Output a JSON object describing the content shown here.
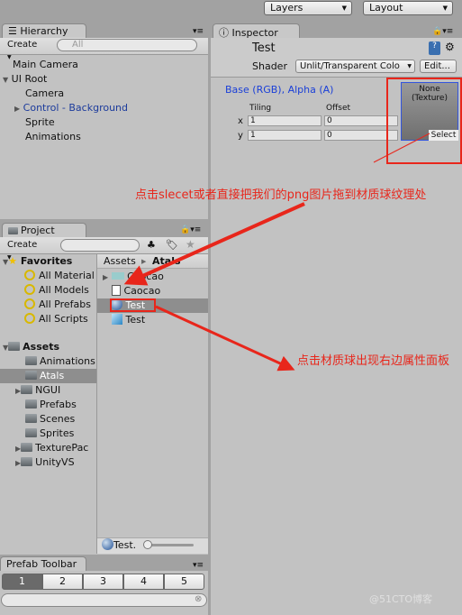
{
  "toolbar": {
    "layers": "Layers",
    "layout": "Layout"
  },
  "hierarchy": {
    "tab": "Hierarchy",
    "create": "Create",
    "search_placeholder": "All",
    "items": [
      "Main Camera",
      "UI Root",
      "Camera",
      "Control - Background",
      "Sprite",
      "Animations"
    ]
  },
  "project": {
    "tab": "Project",
    "create": "Create",
    "favorites": "Favorites",
    "favorite_items": [
      "All Material",
      "All Models",
      "All Prefabs",
      "All Scripts"
    ],
    "assets": "Assets",
    "folders": [
      "Animations",
      "Atals",
      "NGUI",
      "Prefabs",
      "Scenes",
      "Sprites",
      "TexturePac",
      "UnityVS"
    ],
    "breadcrumb": [
      "Assets",
      "Atals"
    ],
    "files": [
      "Caocao",
      "Caocao",
      "Test",
      "Test"
    ],
    "status": "Test."
  },
  "prefab_toolbar": {
    "tab": "Prefab Toolbar",
    "buttons": [
      "1",
      "2",
      "3",
      "4",
      "5"
    ],
    "selected": "1"
  },
  "inspector": {
    "tab": "Inspector",
    "name": "Test",
    "shader_label": "Shader",
    "shader_value": "Unlit/Transparent Colo",
    "edit": "Edit...",
    "property": "Base (RGB), Alpha (A)",
    "tiling": "Tiling",
    "offset": "Offset",
    "x": "x",
    "y": "y",
    "tiling_x": "1",
    "tiling_y": "1",
    "offset_x": "0",
    "offset_y": "0",
    "texture_none": "None",
    "texture_type": "(Texture)",
    "select": "Select"
  },
  "annotations": {
    "drag_hint": "点击slecet或者直接把我们的png图片拖到材质球纹理处",
    "click_hint": "点击材质球出现右边属性面板"
  },
  "watermark": "@51CTO博客",
  "colors": {
    "annotation": "#e8261b",
    "link": "#1a3fd8",
    "selection": "#8e8e8e"
  }
}
